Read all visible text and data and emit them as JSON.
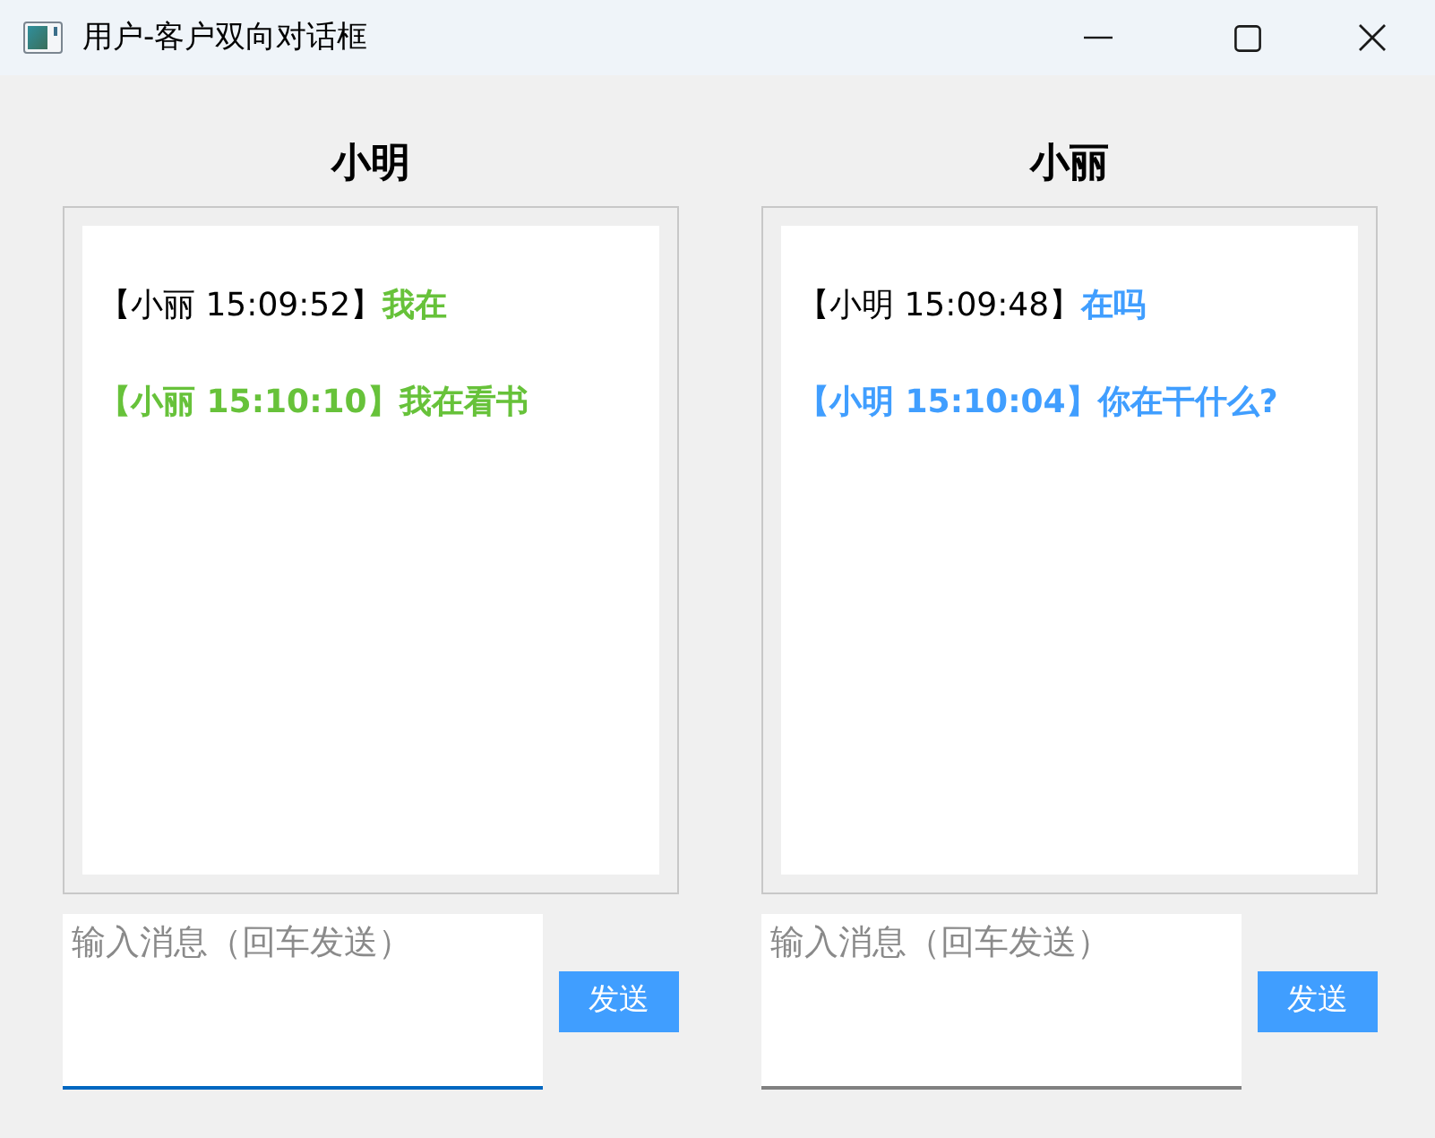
{
  "window": {
    "title": "用户-客户双向对话框"
  },
  "panels": [
    {
      "user": "小明",
      "color": "#67c23a",
      "messages": [
        {
          "header": "【小丽 15:09:52】",
          "text": "我在",
          "highlighted": false
        },
        {
          "header": "【小丽 15:10:10】",
          "text": "我在看书",
          "highlighted": true
        }
      ],
      "input": {
        "placeholder": "输入消息（回车发送）",
        "focused": true
      },
      "send_button": "发送"
    },
    {
      "user": "小丽",
      "color": "#409eff",
      "messages": [
        {
          "header": "【小明 15:09:48】",
          "text": "在吗",
          "highlighted": false
        },
        {
          "header": "【小明 15:10:04】",
          "text": "你在干什么?",
          "highlighted": true
        }
      ],
      "input": {
        "placeholder": "输入消息（回车发送）",
        "focused": false
      },
      "send_button": "发送"
    }
  ]
}
